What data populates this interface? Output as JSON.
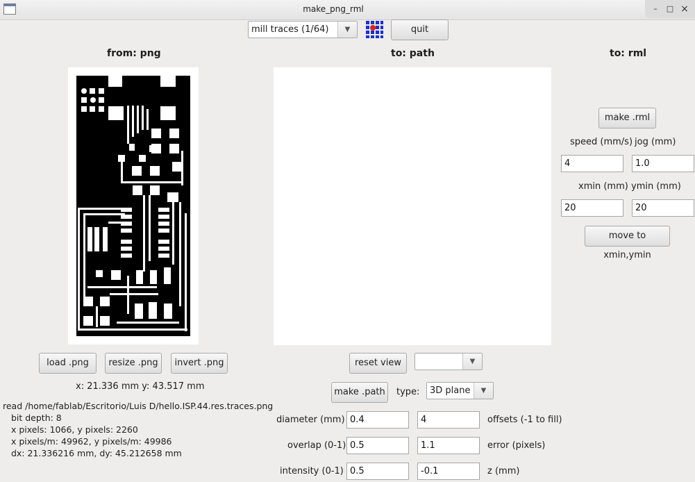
{
  "window": {
    "title": "make_png_rml",
    "ctrl_min": "–",
    "ctrl_max": "□",
    "ctrl_close": "×"
  },
  "toolbar": {
    "mode_value": "mill traces (1/64)",
    "quit_label": "quit",
    "app_icon": "fab-grid-icon"
  },
  "columns": {
    "from_heading": "from: png",
    "to_path_heading": "to: path",
    "to_rml_heading": "to: rml"
  },
  "png": {
    "load_label": "load .png",
    "resize_label": "resize .png",
    "invert_label": "invert .png",
    "coords": "x: 21.336 mm  y: 43.517 mm",
    "info_lines": [
      "read /home/fablab/Escritorio/Luis D/hello.ISP.44.res.traces.png",
      "  bit depth: 8",
      "  x pixels: 1066, y pixels: 2260",
      "  x pixels/m: 49962, y pixels/m: 49986",
      "  dx: 21.336216 mm, dy: 45.212658 mm"
    ]
  },
  "path": {
    "reset_view_label": "reset view",
    "view_value": "",
    "make_path_label": "make .path",
    "type_label": "type:",
    "type_value": "3D plane",
    "diameter_label": "diameter (mm)",
    "diameter_value": "0.4",
    "offsets_value": "4",
    "offsets_label": "offsets (-1 to fill)",
    "overlap_label": "overlap (0-1)",
    "overlap_value": "0.5",
    "error_value": "1.1",
    "error_label": "error (pixels)",
    "intensity_label": "intensity (0-1)",
    "intensity_value": "0.5",
    "z_value": "-0.1",
    "z_label": "z (mm)"
  },
  "rml": {
    "make_rml_label": "make .rml",
    "speed_label": "speed (mm/s)",
    "jog_label": "jog (mm)",
    "speed_value": "4",
    "jog_value": "1.0",
    "xmin_label": "xmin (mm)",
    "ymin_label": "ymin (mm)",
    "xmin_value": "20",
    "ymin_value": "20",
    "move_label": "move to xmin,ymin"
  }
}
